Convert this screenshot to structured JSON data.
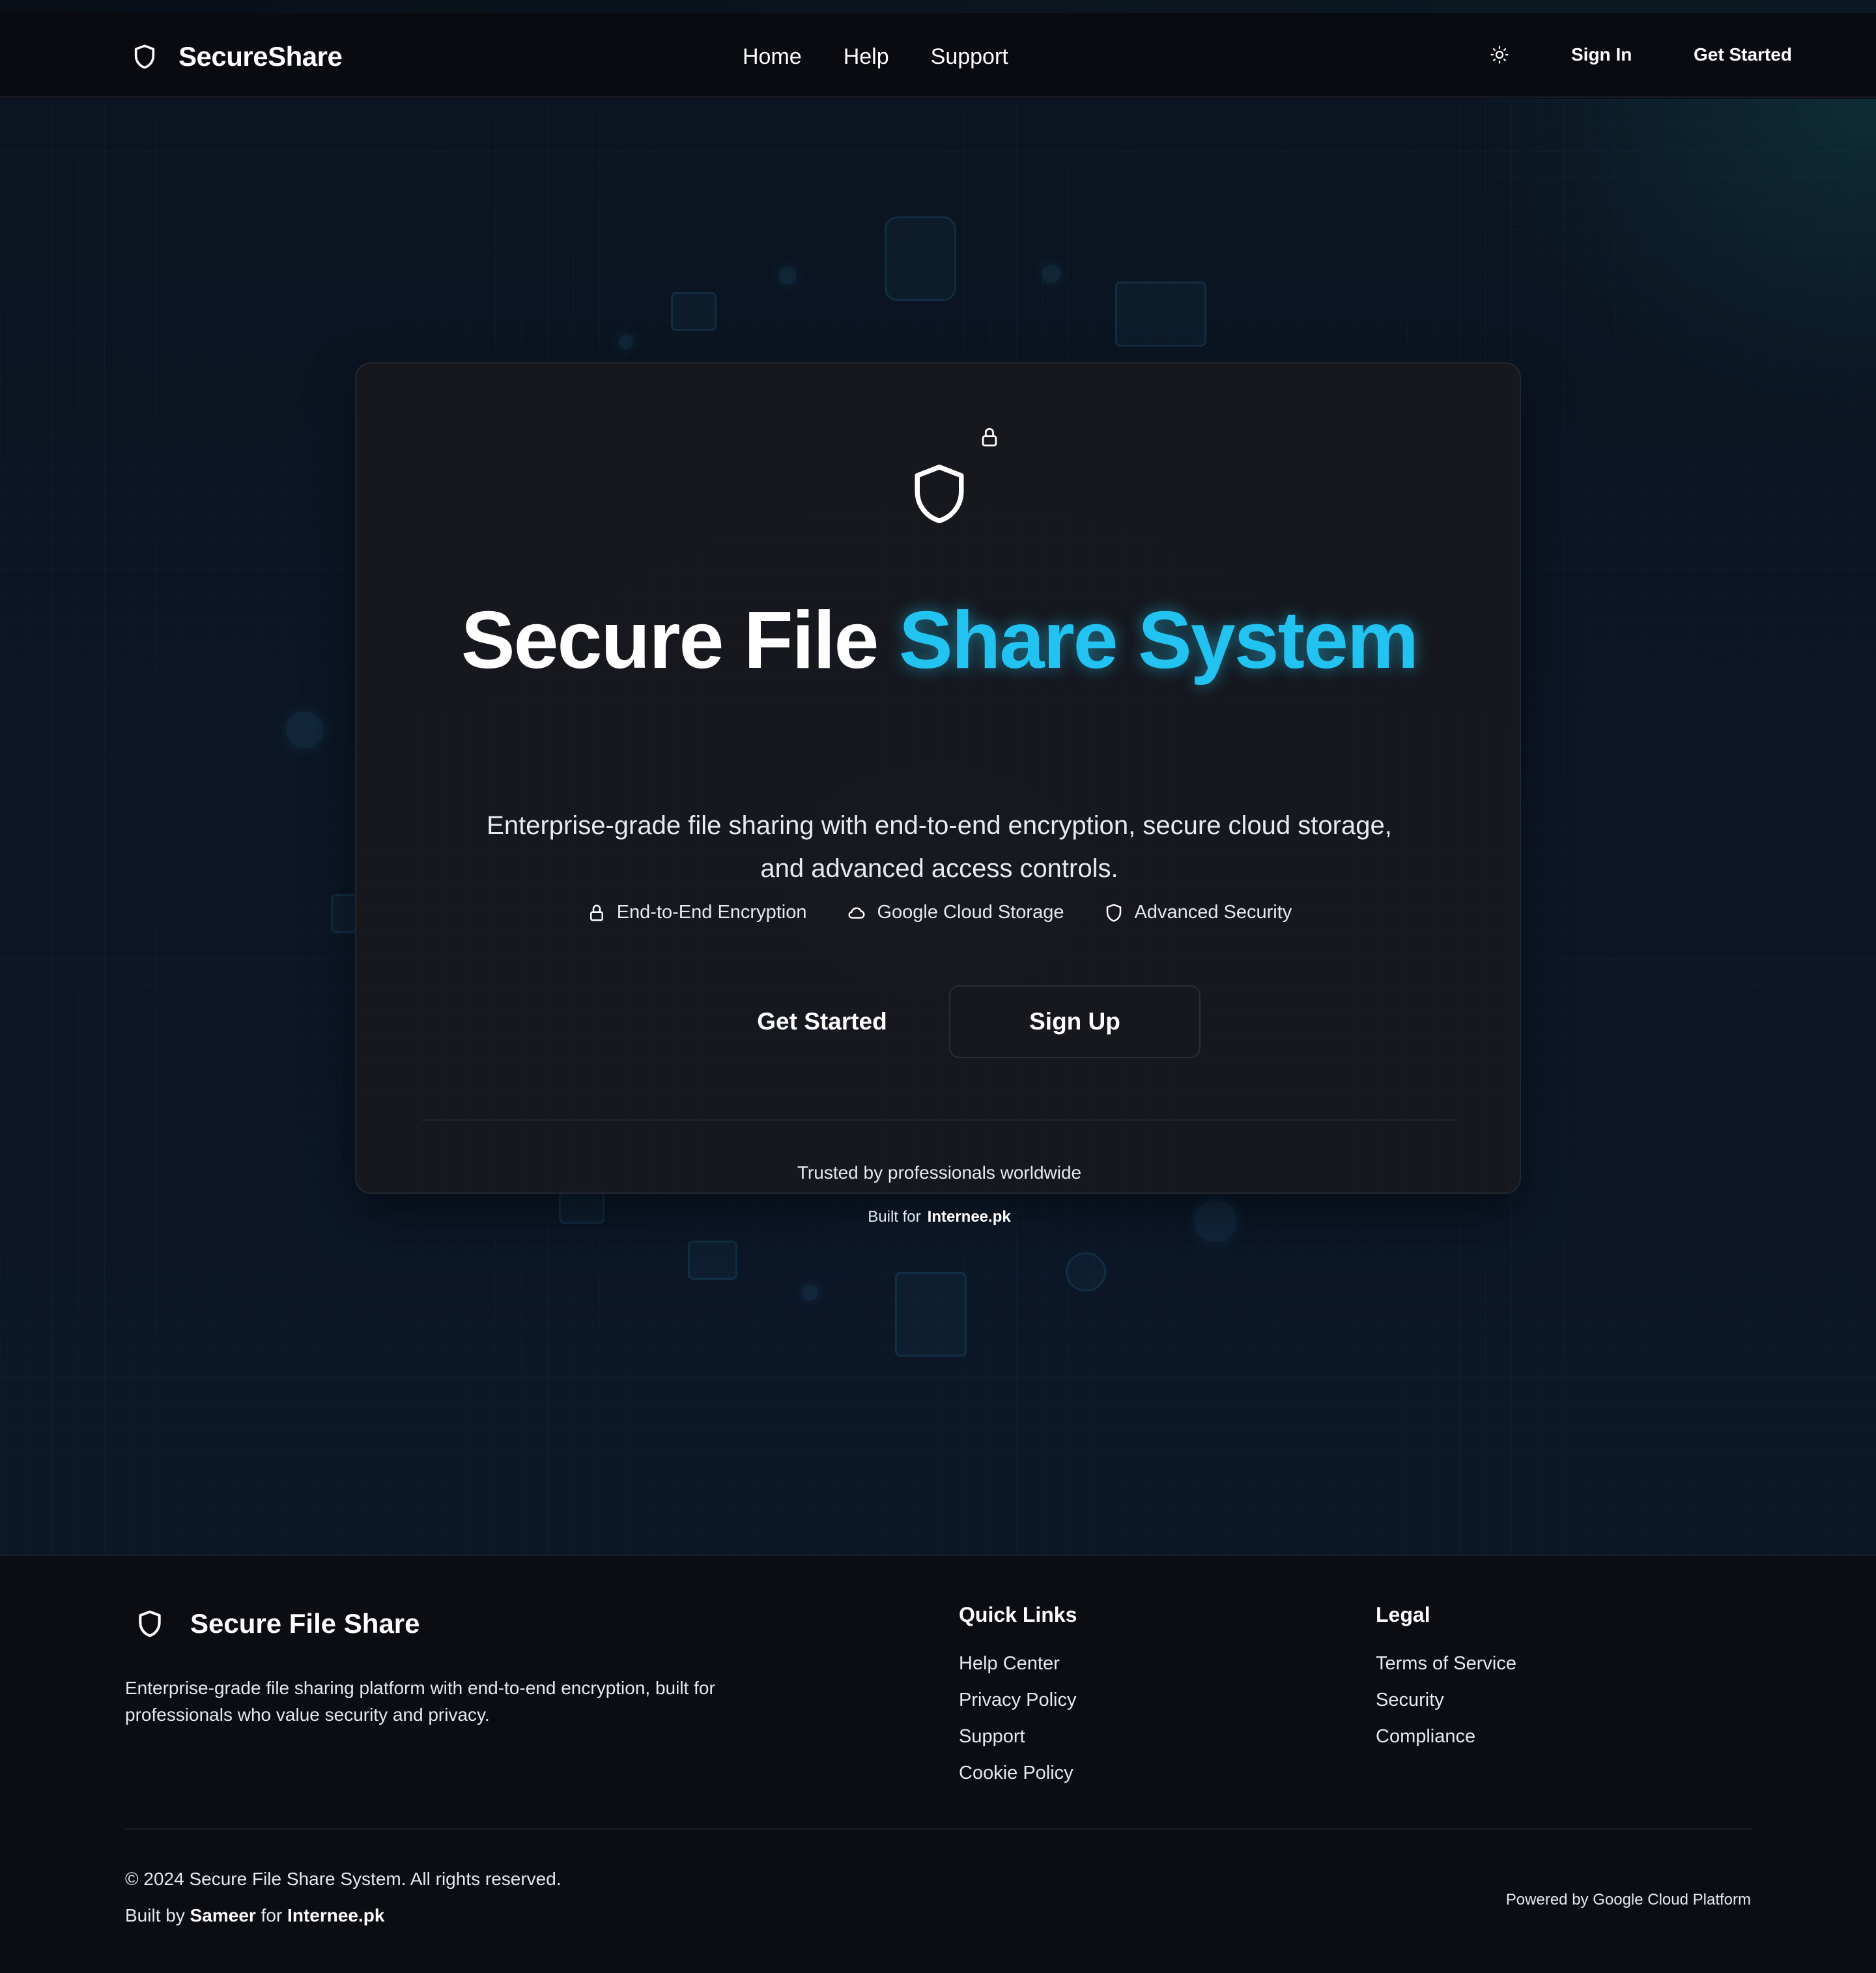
{
  "header": {
    "brand": "SecureShare",
    "nav": [
      "Home",
      "Help",
      "Support"
    ],
    "sign_in": "Sign In",
    "get_started": "Get Started",
    "theme_icon": "sun-icon"
  },
  "hero": {
    "title_plain": "Secure File",
    "title_accent": "Share System",
    "subtitle": "Enterprise-grade file sharing with end-to-end encryption, secure cloud storage, and advanced access controls.",
    "features": [
      {
        "icon": "lock-icon",
        "label": "End-to-End Encryption"
      },
      {
        "icon": "cloud-icon",
        "label": "Google Cloud Storage"
      },
      {
        "icon": "shield-icon",
        "label": "Advanced Security"
      }
    ],
    "cta_primary": "Get Started",
    "cta_secondary": "Sign Up",
    "trusted": "Trusted by professionals worldwide",
    "built_for_label": "Built for",
    "built_for_name": "Internee.pk"
  },
  "footer": {
    "brand": "Secure File Share",
    "description": "Enterprise-grade file sharing platform with end-to-end encryption, built for professionals who value security and privacy.",
    "quick_links": {
      "heading": "Quick Links",
      "items": [
        "Help Center",
        "Privacy Policy",
        "Support",
        "Cookie Policy"
      ]
    },
    "legal": {
      "heading": "Legal",
      "items": [
        "Terms of Service",
        "Security",
        "Compliance"
      ]
    },
    "copyright": "© 2024 Secure File Share System. All rights reserved.",
    "built_by_prefix": "Built by",
    "built_by_name": "Sameer",
    "built_by_mid": "for",
    "built_by_org": "Internee.pk",
    "powered_by": "Powered by Google Cloud Platform"
  },
  "colors": {
    "accent": "#22c3f0",
    "background": "#0b0d13",
    "card": "#18191e"
  }
}
